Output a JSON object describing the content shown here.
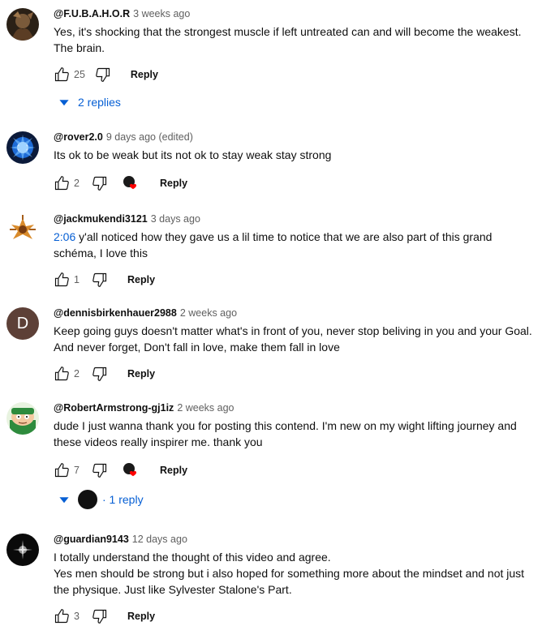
{
  "colors": {
    "link": "#065fd4",
    "text": "#0f0f0f",
    "secondary": "#606060",
    "heart": "#ff0000"
  },
  "comments": [
    {
      "author": "@F.U.B.A.H.O.R",
      "time": "3 weeks ago",
      "lines": [
        "Yes, it's shocking that the strongest muscle if left untreated can and will become the weakest.",
        "The brain."
      ],
      "likes": "25",
      "reply_label": "Reply",
      "replies_label": "2 replies"
    },
    {
      "author": "@rover2.0",
      "time": "9 days ago (edited)",
      "lines": [
        "Its ok to be weak but its not ok to stay weak stay strong"
      ],
      "likes": "2",
      "reply_label": "Reply",
      "hearted": true
    },
    {
      "author": "@jackmukendi3121",
      "time": "3 days ago",
      "timestamp_link": "2:06",
      "lines": [
        " y'all noticed how they gave us a lil time to notice that we are also part of this grand",
        "schéma, I love this"
      ],
      "likes": "1",
      "reply_label": "Reply"
    },
    {
      "author": "@dennisbirkenhauer2988",
      "time": "2 weeks ago",
      "avatar_letter": "D",
      "lines": [
        "Keep going guys doesn't matter what's in front of you, never stop beliving in you and your Goal.",
        "And never forget, Don't fall in love, make them fall in love"
      ],
      "likes": "2",
      "reply_label": "Reply"
    },
    {
      "author": "@RobertArmstrong-gj1iz",
      "time": "2 weeks ago",
      "lines": [
        "dude I just wanna thank you for posting this contend. I'm new on my wight lifting journey and",
        "these videos really inspirer me. thank you"
      ],
      "likes": "7",
      "reply_label": "Reply",
      "hearted": true,
      "replies_label": "· 1 reply"
    },
    {
      "author": "@guardian9143",
      "time": "12 days ago",
      "lines": [
        "I totally understand the thought of this video and agree.",
        "Yes men should be strong but i also hoped for something more about the mindset and not just",
        "the physique. Just like Sylvester Stalone's Part."
      ],
      "likes": "3",
      "reply_label": "Reply"
    }
  ]
}
